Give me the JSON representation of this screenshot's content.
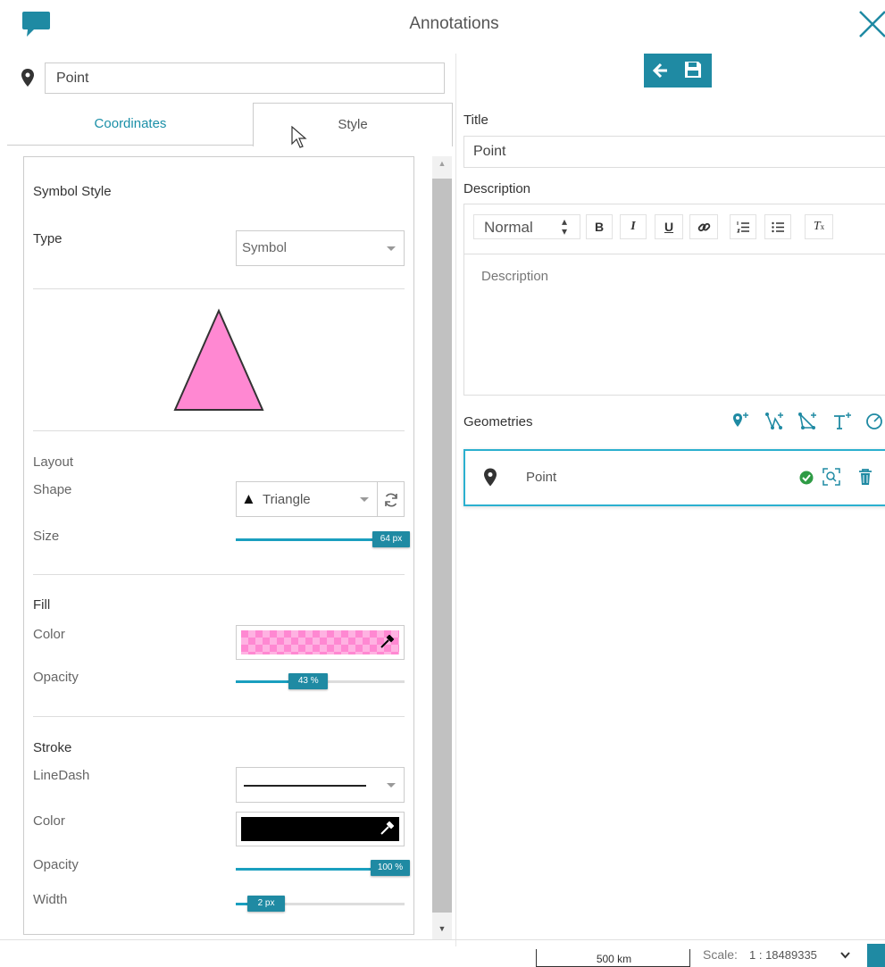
{
  "header": {
    "title": "Annotations"
  },
  "name_field": {
    "value": "Point"
  },
  "tabs": [
    {
      "label": "Coordinates",
      "active": false
    },
    {
      "label": "Style",
      "active": true
    }
  ],
  "style_panel": {
    "symbol_style_heading": "Symbol Style",
    "type_label": "Type",
    "type_value": "Symbol",
    "preview_fill": "#ff88d2",
    "layout_heading": "Layout",
    "shape_label": "Shape",
    "shape_value": "Triangle",
    "shape_glyph": "▲",
    "size_label": "Size",
    "size_value": "64 px",
    "size_fraction": 1.0,
    "fill_heading": "Fill",
    "fill_color_label": "Color",
    "fill_color": "#ff88d2",
    "fill_opacity_label": "Opacity",
    "fill_opacity_value": "43 %",
    "fill_opacity_fraction": 0.43,
    "stroke_heading": "Stroke",
    "linedash_label": "LineDash",
    "stroke_color_label": "Color",
    "stroke_color": "#000000",
    "stroke_opacity_label": "Opacity",
    "stroke_opacity_value": "100 %",
    "stroke_opacity_fraction": 1.0,
    "width_label": "Width",
    "width_value": "2 px",
    "width_fraction": 0.18
  },
  "right_panel": {
    "title_label": "Title",
    "title_value": "Point",
    "description_label": "Description",
    "description_placeholder": "Description",
    "format_select": "Normal",
    "toolbar_buttons": {
      "bold": "B",
      "italic": "I",
      "underline": "U",
      "clear": "T"
    },
    "geometries_label": "Geometries",
    "geometry_item": "Point"
  },
  "footer": {
    "scale_bar_label": "500 km",
    "scale_label": "Scale:",
    "scale_value": "1 : 18489335"
  },
  "colors": {
    "accent": "#1f8aa3",
    "teal_text": "#1a8fa7",
    "valid_green": "#2e9b45",
    "selection_border": "#2bb0cf"
  }
}
